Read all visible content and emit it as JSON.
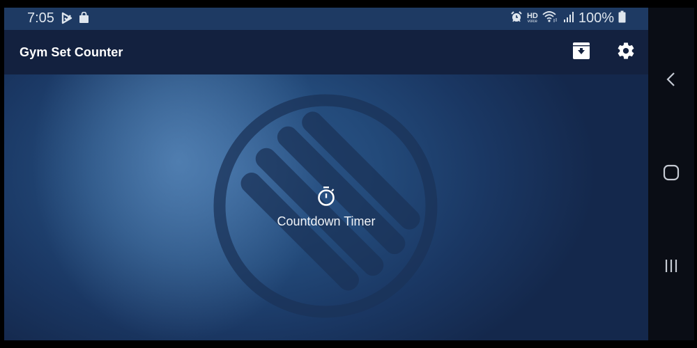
{
  "status_bar": {
    "time": "7:05",
    "left_icons": [
      "play-store-icon",
      "shopping-bag-icon"
    ],
    "right_icons": [
      "alarm-icon",
      "hd-voice-icon",
      "wifi-icon",
      "signal-icon",
      "battery-icon"
    ],
    "hd_label": "HD",
    "voice_label": "voice",
    "battery_percent": "100%"
  },
  "app_bar": {
    "title": "Gym Set Counter",
    "actions": [
      "archive-download-icon",
      "settings-gear-icon"
    ]
  },
  "main": {
    "timer_label": "Countdown Timer",
    "timer_icon": "stopwatch-icon",
    "background_emblem": "dumbbell-circle-emblem"
  },
  "nav_bar": {
    "buttons": [
      "back",
      "home",
      "recents"
    ]
  },
  "colors": {
    "status_bar": "#1e3a63",
    "app_bar": "#13213f",
    "content_bg": "#1f4274",
    "text": "#ffffff",
    "nav_bar": "#0a0d15"
  }
}
